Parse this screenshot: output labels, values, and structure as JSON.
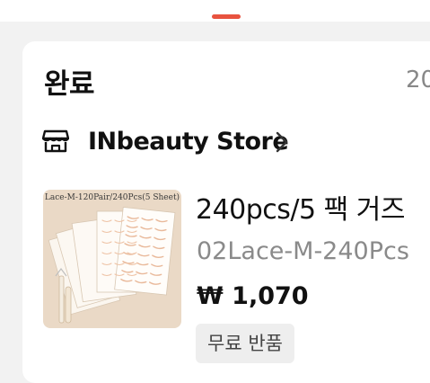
{
  "order": {
    "status": "완료",
    "date_partial": "20"
  },
  "store": {
    "name": "INbeauty Store",
    "icon": "store-icon",
    "chevron_icon": "chevron-right-icon"
  },
  "product": {
    "image_caption": "Lace-M-120Pair/240Pcs(5 Sheet)",
    "title": "240pcs/5 팩 거즈",
    "variant": "02Lace-M-240Pcs",
    "price": "₩ 1,070",
    "badge": "무료 반품"
  },
  "colors": {
    "accent": "#e8533f",
    "muted_text": "#8a8a8a",
    "badge_bg": "#eeeeee"
  }
}
